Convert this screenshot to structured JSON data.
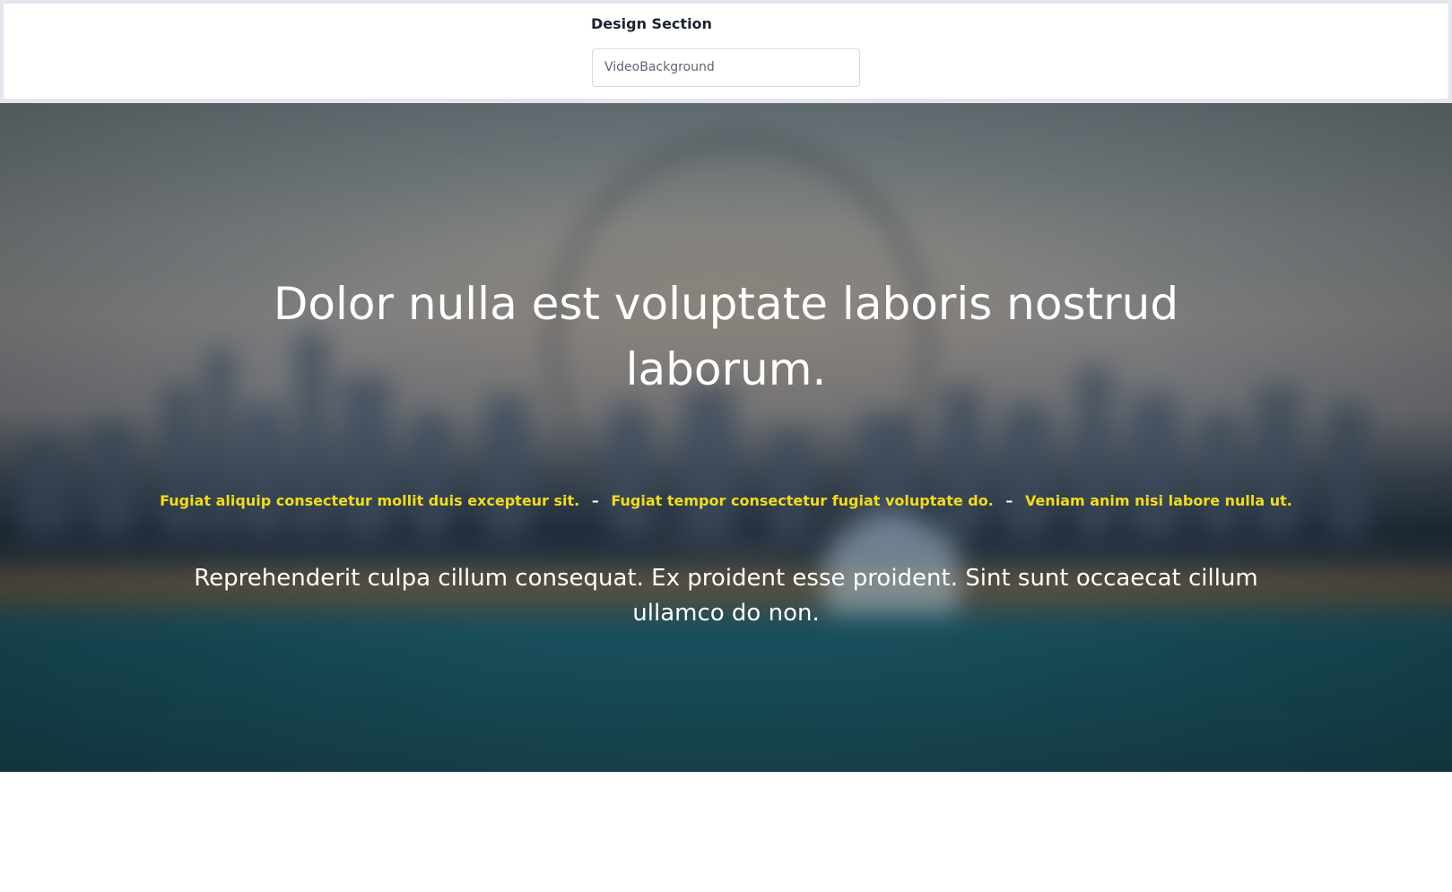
{
  "design_section": {
    "label": "Design Section",
    "selected_value": "VideoBackground"
  },
  "hero": {
    "title": "Dolor nulla est voluptate laboris nostrud laborum.",
    "taglines": [
      "Fugiat aliquip consectetur mollit duis excepteur sit.",
      "Fugiat tempor consectetur fugiat voluptate do.",
      "Veniam anim nisi labore nulla ut."
    ],
    "separator": "–",
    "body": "Reprehenderit culpa cillum consequat. Ex proident esse proident. Sint sunt occaecat cillum ullamco do non."
  },
  "colors": {
    "tagline": "#f2dc1a",
    "hero_text": "#ffffff",
    "label_text": "#1c2330",
    "frame": "#e3e6ee"
  }
}
